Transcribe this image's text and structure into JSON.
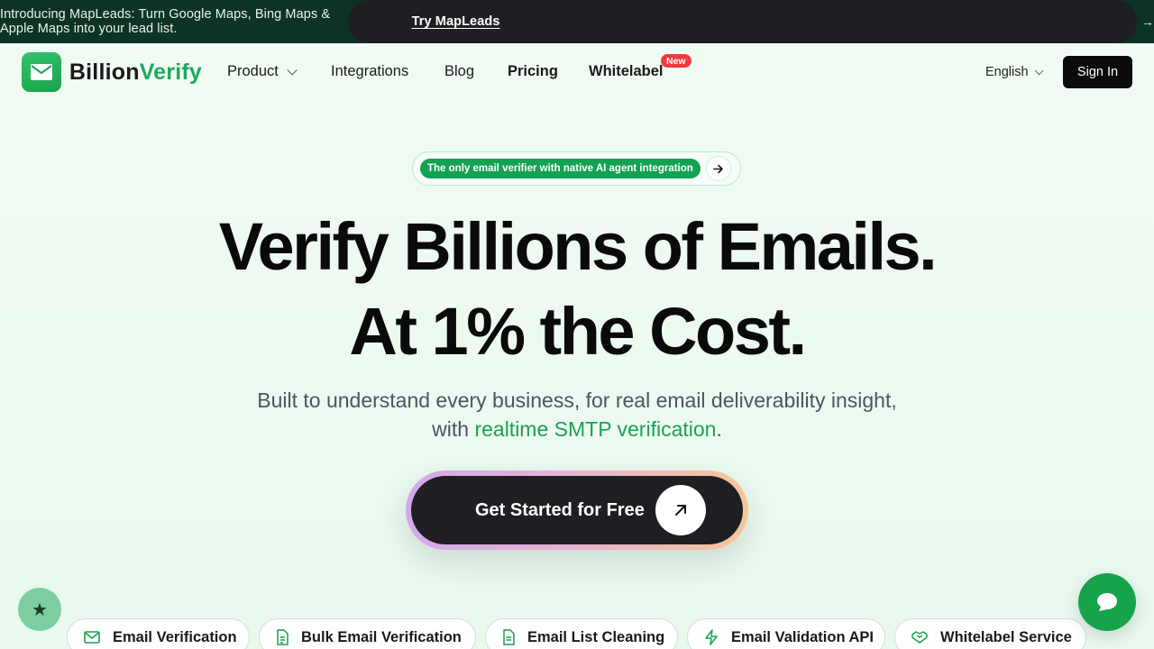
{
  "announcement": {
    "text": "Introducing MapLeads: Turn Google Maps, Bing Maps & Apple Maps into your lead list.",
    "cta_label": "Try MapLeads",
    "arrow": "→"
  },
  "nav": {
    "logo_part1": "Billion",
    "logo_part2": "Verify",
    "items": [
      {
        "label": "Product"
      },
      {
        "label": "Integrations"
      },
      {
        "label": "Blog"
      },
      {
        "label": "Pricing"
      },
      {
        "label": "Whitelabel"
      }
    ],
    "new_badge": "New",
    "language": "English",
    "signin_label": "Sign In"
  },
  "hero": {
    "pill_label": "The only email verifier with native AI agent integration",
    "headline_line1": "Verify Billions of Emails.",
    "headline_line2": "At 1% the Cost.",
    "sub_line1": "Built to understand every business, for real email deliverability insight,",
    "sub_line2_prefix": "with ",
    "sub_line2_highlight": "realtime SMTP verification",
    "sub_line2_suffix": ".",
    "cta_label": "Get Started for Free"
  },
  "feature_chips": [
    {
      "label": "Email Verification",
      "icon": "mail-icon"
    },
    {
      "label": "Bulk Email Verification",
      "icon": "file-list-icon"
    },
    {
      "label": "Email List Cleaning",
      "icon": "file-text-icon"
    },
    {
      "label": "Email Validation API",
      "icon": "lightning-icon"
    },
    {
      "label": "Whitelabel Service",
      "icon": "handshake-icon"
    }
  ],
  "floating": {
    "star_glyph": "★"
  },
  "colors": {
    "brand_green": "#22a85a",
    "announce_bg": "#0d3324",
    "new_badge": "#ef3b3b",
    "cta_bg": "#1f1f23"
  }
}
